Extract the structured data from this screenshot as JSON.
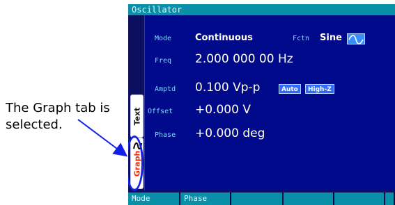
{
  "callout": {
    "text": "The Graph tab is selected."
  },
  "window": {
    "title": "Oscillator"
  },
  "tabs": [
    {
      "label": "Text"
    },
    {
      "label": "Graph"
    }
  ],
  "params": {
    "mode": {
      "label": "Mode",
      "value": "Continuous"
    },
    "fctn": {
      "label": "Fctn",
      "value": "Sine",
      "icon": "sine-wave-icon"
    },
    "freq": {
      "label": "Freq",
      "value": "2.000 000 00 Hz"
    },
    "amptd": {
      "label": "Amptd",
      "value": "0.100 Vp-p",
      "badges": [
        "Auto",
        "High-Z"
      ]
    },
    "offset": {
      "label": "Offset",
      "value": "+0.000 V"
    },
    "phase": {
      "label": "Phase",
      "value": "+0.000 deg"
    }
  },
  "softkeys": [
    "Mode",
    "Phase",
    "",
    "",
    "",
    ""
  ],
  "colors": {
    "screen_bg": "#0b0f5e",
    "panel_bg": "#000a8a",
    "titlebar": "#0a8fa8",
    "label": "#7fd8ff",
    "value": "#ffffe8",
    "badge": "#2d6cff",
    "highlight": "#1020e8",
    "graph_tab_text": "#ff2a00"
  }
}
